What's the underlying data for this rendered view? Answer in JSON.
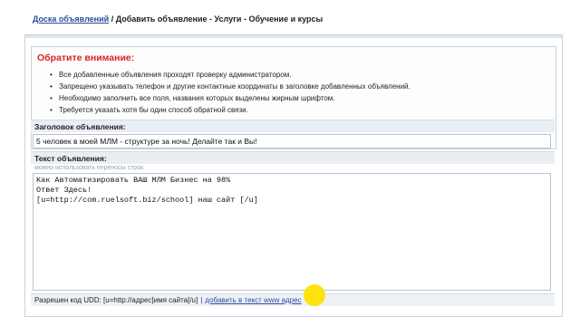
{
  "breadcrumb": {
    "home_link": "Доска объявлений",
    "rest": " / Добавить объявление - Услуги - Обучение и курсы"
  },
  "notice": {
    "title": "Обратите внимание:",
    "items": [
      "Все добавленные объявления проходят проверку администратором.",
      "Запрещено указывать телефон и другие контактные координаты в заголовке добавленных объявлений.",
      "Необходимо заполнить все поля, названия которых выделены жирным шрифтом.",
      "Требуется указать хотя бы один способ обратной связи."
    ]
  },
  "title_field": {
    "label": "Заголовок объявления:",
    "value": "5 человек в моей МЛМ - структуре за ночь! Делайте так и Вы!"
  },
  "body_field": {
    "label": "Текст объявления:",
    "hint": "можно использовать переносы строк",
    "value": "Как Автоматизировать ВАШ МЛМ Бизнес на 98%\nОтвет Здесь!\n[u=http://com.ruelsoft.biz/school] наш сайт [/u]"
  },
  "footer": {
    "allowed_code": "Разрешен код UDD: [u=http://адрес]имя сайта[/u]",
    "separator": "|",
    "add_link": "добавить в текст www адрес"
  },
  "colors": {
    "accent_red": "#d2252a",
    "link_blue": "#2a4f9a",
    "cursor_highlight": "#ffe100"
  }
}
